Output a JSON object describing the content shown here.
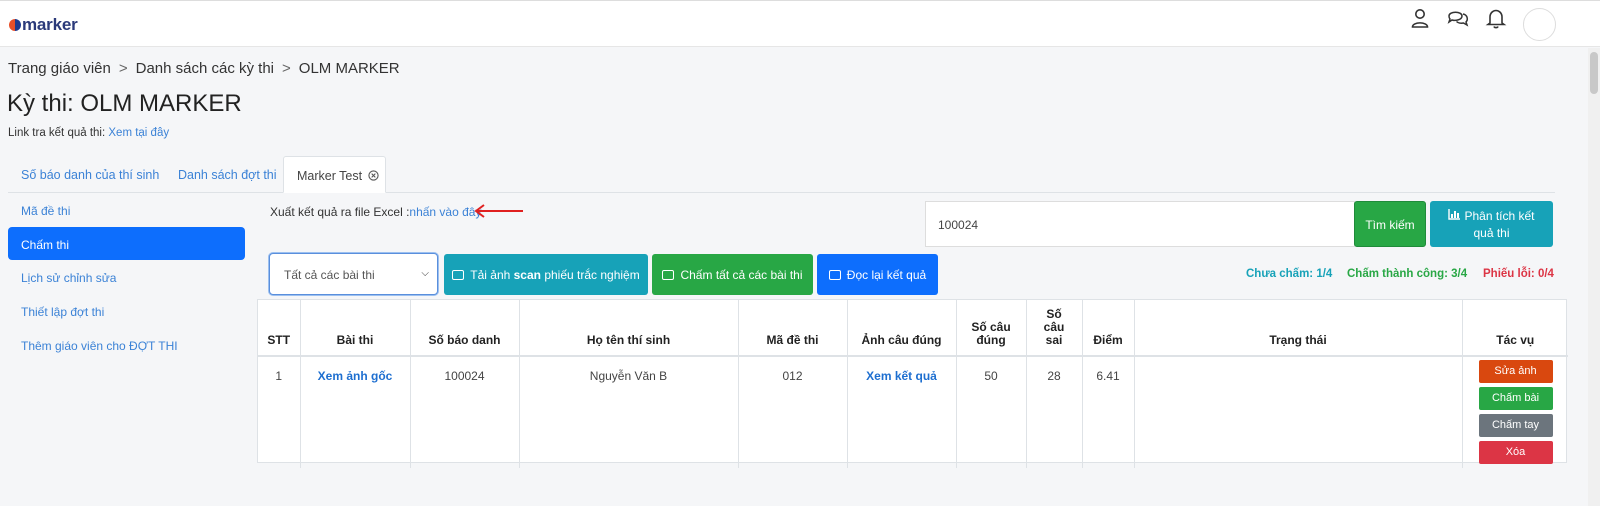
{
  "app": {
    "logo_text": "marker"
  },
  "header": {
    "icons": [
      "user-icon",
      "chat-icon",
      "bell-icon",
      "avatar"
    ]
  },
  "breadcrumb": {
    "items": [
      "Trang giáo viên",
      "Danh sách các kỳ thi",
      "OLM MARKER"
    ],
    "separator": ">"
  },
  "page": {
    "title": "Kỳ thi: OLM MARKER",
    "result_link_label": "Link tra kết quả thi:",
    "result_link_text": "Xem tại đây"
  },
  "tabs": [
    {
      "label": "Số báo danh của thí sinh",
      "active": false
    },
    {
      "label": "Danh sách đợt thi",
      "active": false
    },
    {
      "label": "Marker Test",
      "active": true,
      "close_icon": "close-circle-icon"
    }
  ],
  "sidebar": {
    "items": [
      {
        "label": "Mã đề thi",
        "active": false
      },
      {
        "label": "Chấm thi",
        "active": true
      },
      {
        "label": "Lịch sử chỉnh sửa",
        "active": false
      },
      {
        "label": "Thiết lập đợt thi",
        "active": false
      },
      {
        "label": "Thêm giáo viên cho ĐỢT THI",
        "active": false
      }
    ]
  },
  "export": {
    "label": "Xuất kết quả ra file Excel :",
    "link": "nhấn vào đây"
  },
  "search": {
    "value": "100024",
    "button": "Tìm kiếm"
  },
  "analyze_button": {
    "line1": "Phân tích kết",
    "line2": "quả thi"
  },
  "filter": {
    "selected": "Tất cả các bài thi"
  },
  "toolbar": {
    "upload_prefix": "Tải ảnh ",
    "upload_bold": "scan",
    "upload_suffix": " phiếu trắc nghiệm",
    "grade_all": "Chấm tất cả các bài thi",
    "reread": "Đọc lại kết quả"
  },
  "stats": {
    "ungraded": "Chưa chấm: 1/4",
    "success": "Chấm thành công: 3/4",
    "error": "Phiếu lỗi: 0/4",
    "colors": {
      "ungraded": "#17a2b8",
      "success": "#28a745",
      "error": "#dc3545"
    }
  },
  "table": {
    "headers": {
      "stt": "STT",
      "exam": "Bài thi",
      "sbd": "Số báo danh",
      "name": "Họ tên thí sinh",
      "code": "Mã đề thi",
      "answer_img": "Ảnh câu đúng",
      "correct": "Số câu đúng",
      "wrong_l1": "Số",
      "wrong_l2": "câu",
      "wrong_l3": "sai",
      "score": "Điểm",
      "status": "Trạng thái",
      "actions": "Tác vụ"
    },
    "rows": [
      {
        "stt": "1",
        "exam": "Xem ảnh gốc",
        "sbd": "100024",
        "name": "Nguyễn Văn B",
        "code": "012",
        "answer_img": "Xem kết quả",
        "correct": "50",
        "wrong": "28",
        "score": "6.41",
        "status": "",
        "actions": {
          "edit_image": "Sửa ảnh",
          "grade": "Chấm bài",
          "manual": "Chấm tay",
          "delete": "Xóa"
        }
      }
    ]
  }
}
